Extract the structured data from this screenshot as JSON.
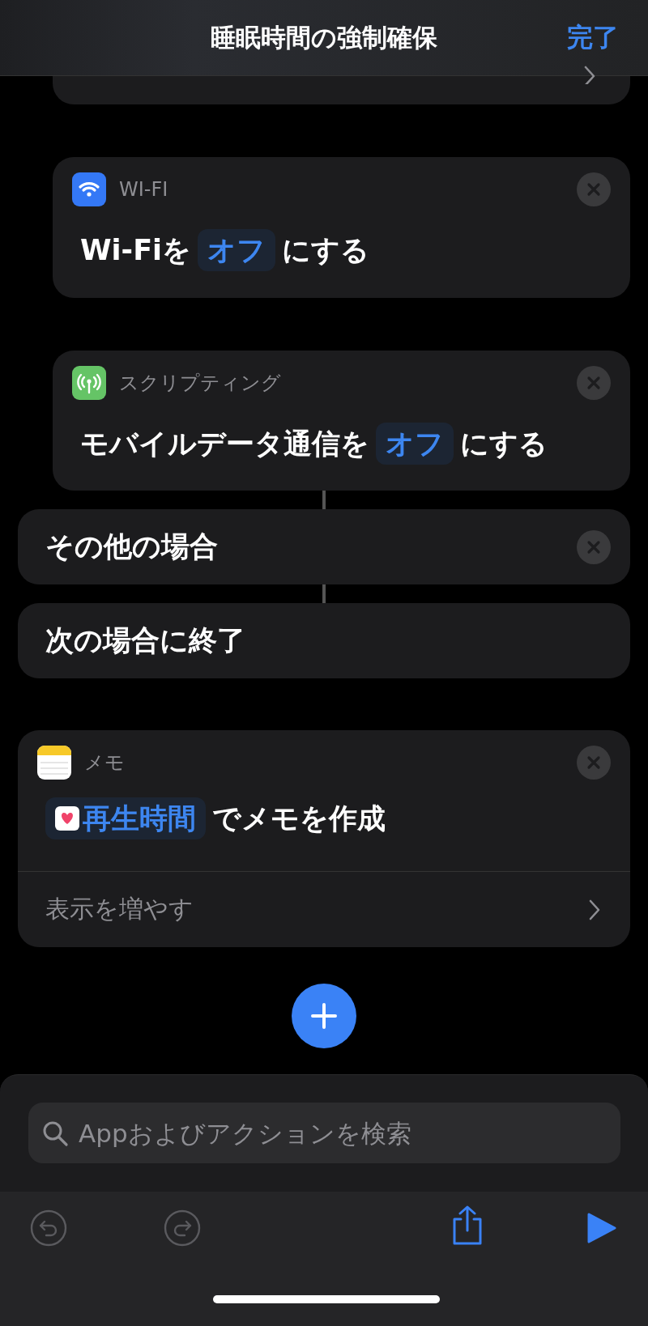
{
  "nav": {
    "title": "睡眠時間の強制確保",
    "done": "完了"
  },
  "blocks": [
    {
      "kind": "branch",
      "children": [
        {
          "kind": "partial"
        },
        {
          "kind": "action",
          "app": {
            "kind": "wifi",
            "name": "WI-FI"
          },
          "removable": true,
          "parts": [
            {
              "kind": "text",
              "text": "Wi-Fiを"
            },
            {
              "kind": "token",
              "text": "オフ"
            },
            {
              "kind": "text",
              "text": "にする"
            }
          ]
        },
        {
          "kind": "action",
          "app": {
            "kind": "cellular",
            "name": "スクリプティング"
          },
          "removable": true,
          "parts": [
            {
              "kind": "text",
              "text": "モバイルデータ通信を"
            },
            {
              "kind": "token",
              "text": "オフ"
            },
            {
              "kind": "text",
              "text": "にする"
            }
          ]
        }
      ]
    },
    {
      "kind": "control",
      "label": "その他の場合",
      "removable": true
    },
    {
      "kind": "control",
      "label": "次の場合に終了",
      "removable": false
    },
    {
      "kind": "action",
      "app": {
        "kind": "notes",
        "name": "メモ"
      },
      "removable": true,
      "parts": [
        {
          "kind": "health_token",
          "text": "再生時間"
        },
        {
          "kind": "text",
          "text": "でメモを作成"
        }
      ],
      "more": "表示を増やす"
    }
  ],
  "search": {
    "placeholder": "Appおよびアクションを検索"
  },
  "toolbar": [
    {
      "kind": "undo",
      "disabled": true
    },
    {
      "kind": "redo",
      "disabled": true
    },
    {
      "kind": "share",
      "disabled": false
    },
    {
      "kind": "run",
      "disabled": false
    }
  ]
}
